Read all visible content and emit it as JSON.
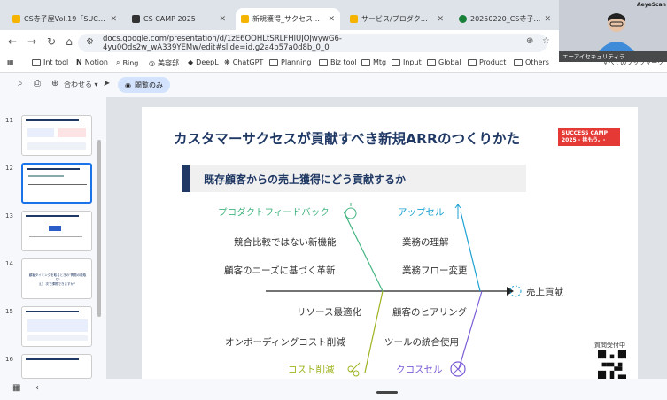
{
  "tabs": [
    {
      "label": "CS寺子屋Vol.19「SUCCESS",
      "color": "#f4b400"
    },
    {
      "label": "CS CAMP 2025",
      "color": "#333333"
    },
    {
      "label": "新規獲得_サクセスキャンプ",
      "color": "#f4b400"
    },
    {
      "label": "サービス/プロダクト開発_サ",
      "color": "#f4b400"
    },
    {
      "label": "20250220_CS寺子屋Vol.1",
      "color": "#188038"
    }
  ],
  "address": {
    "url": "docs.google.com/presentation/d/1zE6OOHLtSRLFHlUJOJwywG6-4yu0Ods2w_wA339YEMw/edit#slide=id.g2a4b57a0d8b_0_0"
  },
  "bookmarks": [
    "Int tool",
    "Notion",
    "Bing",
    "美容部",
    "DeepL",
    "ChatGPT",
    "Planning",
    "Biz tool",
    "Mtg",
    "Input",
    "Global",
    "Product",
    "Others"
  ],
  "bookmarks_all": "すべてのブックマーク",
  "toolbar": {
    "zoom_label": "合わせる",
    "view_only_label": "閲覧のみ"
  },
  "filmstrip": {
    "numbers": [
      "11",
      "12",
      "13",
      "14",
      "15",
      "16"
    ],
    "thumb14_text": "顧客タイミングを取るときの\"問題の段取り\"\nえ？ 次で課題できますか？"
  },
  "slide": {
    "title": "カスタマーサクセスが貢献すべき新規ARRのつくりかた",
    "badge_line1": "SUCCESS CAMP",
    "badge_line2": "2025 - 挑もう。-",
    "subtitle": "既存顧客からの売上獲得にどう貢献するか",
    "upper_left_head": "プロダクトフィードバック",
    "upper_left_1": "競合比較ではない新機能",
    "upper_left_2": "顧客のニーズに基づく革新",
    "upper_right_head": "アップセル",
    "upper_right_1": "業務の理解",
    "upper_right_2": "業務フロー変更",
    "lower_left_1": "リソース最適化",
    "lower_left_2": "オンボーディングコスト削減",
    "lower_left_head": "コスト削減",
    "lower_right_1": "顧客のヒアリング",
    "lower_right_2": "ツールの統合使用",
    "lower_right_head": "クロスセル",
    "result": "売上貢献",
    "qr_label": "質問受付中"
  },
  "webcam": {
    "banner": "エーアイセキュリティラ...",
    "brand": "AeyeScan"
  },
  "colors": {
    "green": "#43b581",
    "cyan": "#1ba1d2",
    "olive": "#9fb31e",
    "purple": "#7a5bd5",
    "navy": "#1f3864",
    "accent": "#1a73e8"
  }
}
